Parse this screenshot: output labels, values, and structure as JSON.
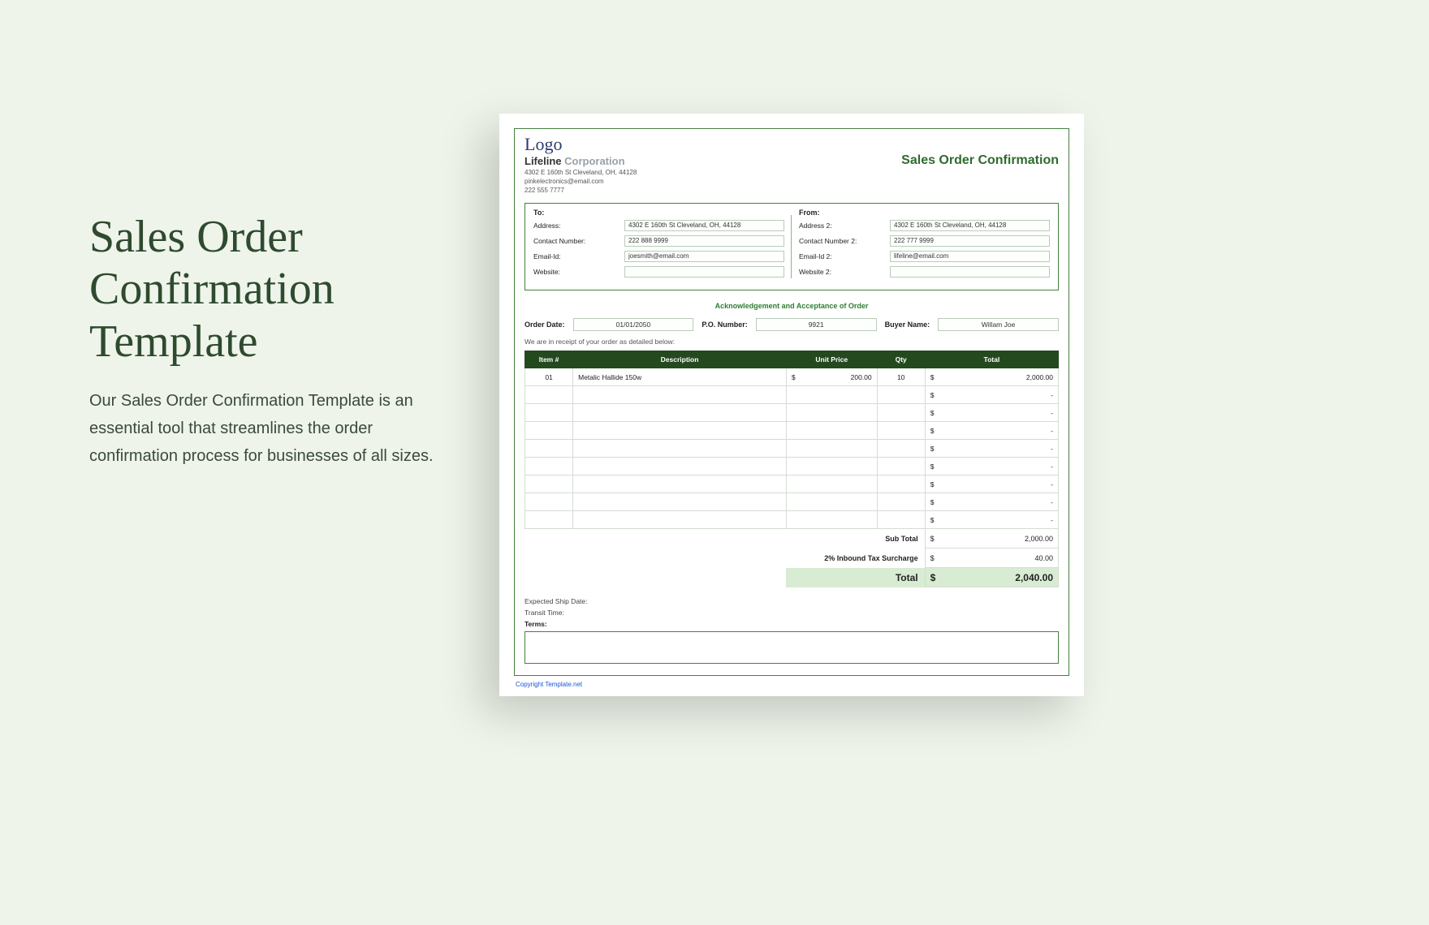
{
  "hero": {
    "title": "Sales Order Confirmation Template",
    "body": "Our Sales Order Confirmation Template is an essential tool that streamlines the order confirmation process for businesses of all sizes."
  },
  "doc": {
    "logo_script": "Logo",
    "company_name_a": "Lifeline",
    "company_name_b": " Corporation",
    "address": "4302 E 160th St Cleveland, OH, 44128",
    "email": "pinkelectronics@email.com",
    "phone": "222 555 7777",
    "title": "Sales Order Confirmation",
    "to": {
      "heading": "To:",
      "rows": [
        {
          "label": "Address:",
          "value": "4302 E 160th St Cleveland, OH, 44128"
        },
        {
          "label": "Contact Number:",
          "value": "222 888 9999"
        },
        {
          "label": "Email-Id:",
          "value": "joesmith@email.com"
        },
        {
          "label": "Website:",
          "value": ""
        }
      ]
    },
    "from": {
      "heading": "From:",
      "rows": [
        {
          "label": "Address 2:",
          "value": "4302 E 160th St Cleveland, OH, 44128"
        },
        {
          "label": "Contact Number 2:",
          "value": "222 777 9999"
        },
        {
          "label": "Email-Id 2:",
          "value": "lifeline@email.com"
        },
        {
          "label": "Website 2:",
          "value": ""
        }
      ]
    },
    "ack": "Acknowledgement and Acceptance of Order",
    "meta": {
      "order_date_label": "Order Date:",
      "order_date": "01/01/2050",
      "po_label": "P.O. Number:",
      "po": "9921",
      "buyer_label": "Buyer Name:",
      "buyer": "Willam Joe"
    },
    "receipt_note": "We are in receipt of your order as detailed below:",
    "columns": {
      "item": "Item #",
      "desc": "Description",
      "unit": "Unit Price",
      "qty": "Qty",
      "total": "Total"
    },
    "currency": "$",
    "dash": "-",
    "rows": [
      {
        "item": "01",
        "desc": "Metalic Hallide 150w",
        "unit": "200.00",
        "qty": "10",
        "total": "2,000.00"
      }
    ],
    "empty_rows": 8,
    "totals": {
      "sub_label": "Sub Total",
      "sub_value": "2,000.00",
      "tax_label": "2% Inbound Tax Surcharge",
      "tax_value": "40.00",
      "grand_label": "Total",
      "grand_value": "2,040.00"
    },
    "footer": {
      "ship_date": "Expected Ship Date:",
      "transit": "Transit Time:",
      "terms": "Terms:"
    },
    "copyright": "Copyright Template.net"
  }
}
